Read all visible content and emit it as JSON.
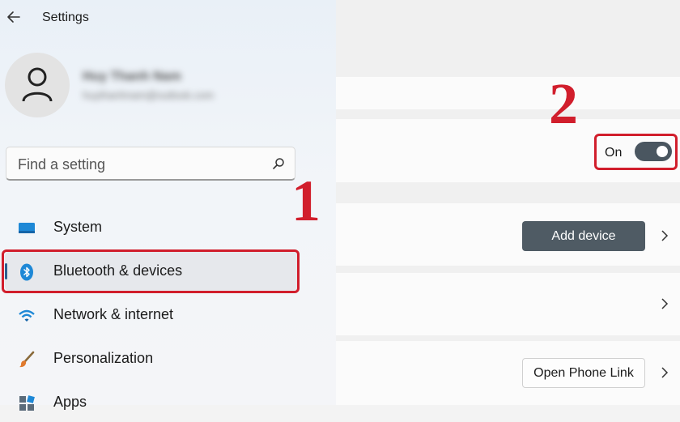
{
  "window": {
    "title": "Settings"
  },
  "sidebar": {
    "user": {
      "name": "Huy Thanh Nam",
      "email": "huythanhnam@outlook.com"
    },
    "search": {
      "placeholder": "Find a setting"
    },
    "items": [
      {
        "label": "System",
        "icon": "system-icon",
        "selected": false
      },
      {
        "label": "Bluetooth & devices",
        "icon": "bluetooth-icon",
        "selected": true
      },
      {
        "label": "Network & internet",
        "icon": "wifi-icon",
        "selected": false
      },
      {
        "label": "Personalization",
        "icon": "brush-icon",
        "selected": false
      },
      {
        "label": "Apps",
        "icon": "apps-icon",
        "selected": false
      }
    ]
  },
  "main": {
    "bluetooth_toggle": {
      "label": "On",
      "state": true
    },
    "add_device_button": "Add device",
    "open_phone_link_button": "Open Phone Link"
  },
  "annotations": {
    "step1": "1",
    "step2": "2",
    "color": "#d11e2c"
  },
  "colors": {
    "accent": "#2c5f8e",
    "toggle_on": "#4a5660"
  }
}
